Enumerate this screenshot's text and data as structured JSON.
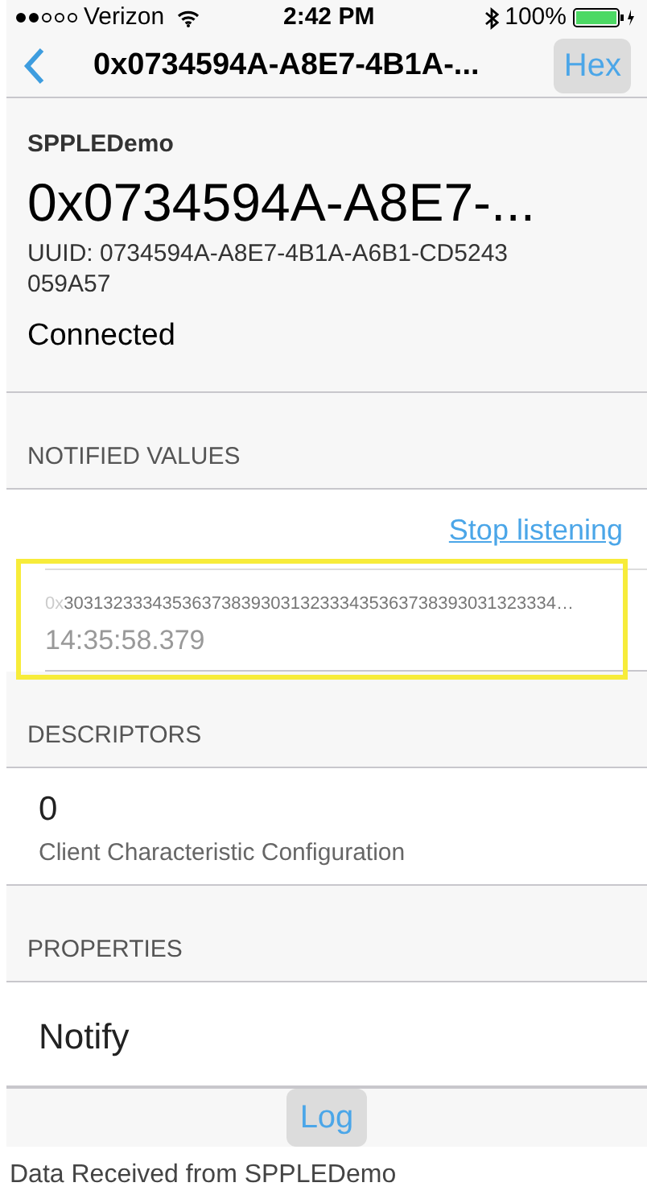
{
  "status_bar": {
    "signal_dots": [
      {
        "filled": true
      },
      {
        "filled": true
      },
      {
        "filled": false
      },
      {
        "filled": false
      },
      {
        "filled": false
      }
    ],
    "carrier": "Verizon",
    "time": "2:42 PM",
    "battery_text": "100%"
  },
  "nav_bar": {
    "title": "0x0734594A-A8E7-4B1A-...",
    "right_button": "Hex"
  },
  "header": {
    "device_name": "SPPLEDemo",
    "value": "0x0734594A-A8E7-...",
    "uuid": "UUID: 0734594A-A8E7-4B1A-A6B1-CD5243059A57",
    "status": "Connected"
  },
  "sections": [
    {
      "title": "NOTIFIED VALUES",
      "kind": "notified",
      "action": "Stop listening",
      "entries": [
        {
          "prefix": "0x",
          "value": "30313233343536373839303132333435363738393031323334…",
          "time": "14:35:58.379",
          "highlighted": true
        }
      ]
    },
    {
      "title": "DESCRIPTORS",
      "kind": "descriptor",
      "rows": [
        {
          "value": "0",
          "label": "Client Characteristic Configuration"
        }
      ]
    },
    {
      "title": "PROPERTIES",
      "kind": "property",
      "rows": [
        {
          "value": "Notify"
        }
      ]
    }
  ],
  "toolbar": {
    "button": "Log"
  },
  "caption": "Data Received from SPPLEDemo"
}
